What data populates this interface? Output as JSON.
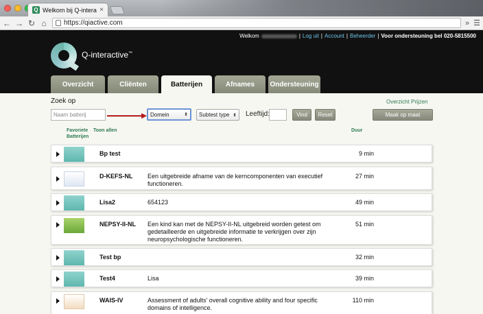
{
  "browser": {
    "tab_title": "Welkom bij Q-interactive",
    "tab_close": "×",
    "url": "https://qiactive.com",
    "more": "»",
    "menu": "☰"
  },
  "header": {
    "welcome": "Welkom",
    "links": [
      "Log uit",
      "Account",
      "Beheerder"
    ],
    "separator": "|",
    "support": "Voor ondersteuning bel 020-5815500",
    "brand": "Q-interactive",
    "brand_tm": "™"
  },
  "nav": {
    "tabs": [
      "Overzicht",
      "Cliënten",
      "Batterijen",
      "Afnames",
      "Ondersteuning"
    ],
    "active_index": 2
  },
  "search": {
    "label": "Zoek op",
    "prices_link": "Overzicht Prijzen",
    "name_placeholder": "Naam batterij",
    "domain_value": "Domein",
    "subtest_value": "Subtest type",
    "age_label": "Leeftijd:",
    "find_button": "Vind",
    "reset_button": "Reset",
    "custom_button": "Maak op maat"
  },
  "columns": {
    "favorites": "Favoriete Batterijen",
    "show_all": "Toon allen",
    "duration": "Duur"
  },
  "batteries": [
    {
      "name": "Bp test",
      "description": "",
      "duration": "9 min",
      "thumb": "teal"
    },
    {
      "name": "D-KEFS-NL",
      "description": "Een uitgebreide afname van de kerncomponenten van executief functioneren.",
      "duration": "27 min",
      "thumb": "white"
    },
    {
      "name": "Lisa2",
      "description": "654123",
      "duration": "49 min",
      "thumb": "teal"
    },
    {
      "name": "NEPSY-II-NL",
      "description": "Een kind kan met de NEPSY-II-NL uitgebreid worden getest om gedetailleerde en uitgebreide informatie te verkrijgen over zijn neuropsychologische functioneren.",
      "duration": "51 min",
      "thumb": "green"
    },
    {
      "name": "Test bp",
      "description": "",
      "duration": "32 min",
      "thumb": "teal"
    },
    {
      "name": "Test4",
      "description": "Lisa",
      "duration": "39 min",
      "thumb": "teal"
    },
    {
      "name": "WAIS-IV",
      "description": "Assessment of adults' overall cognitive ability and four specific domains of intelligence.",
      "duration": "110 min",
      "thumb": "orange"
    }
  ],
  "colors": {
    "header_bg": "#111111",
    "link": "#6ec3e8",
    "accent_green": "#2d7a52",
    "tab_bg": "#9a9e8b",
    "arrow_red": "#b31b1b"
  }
}
